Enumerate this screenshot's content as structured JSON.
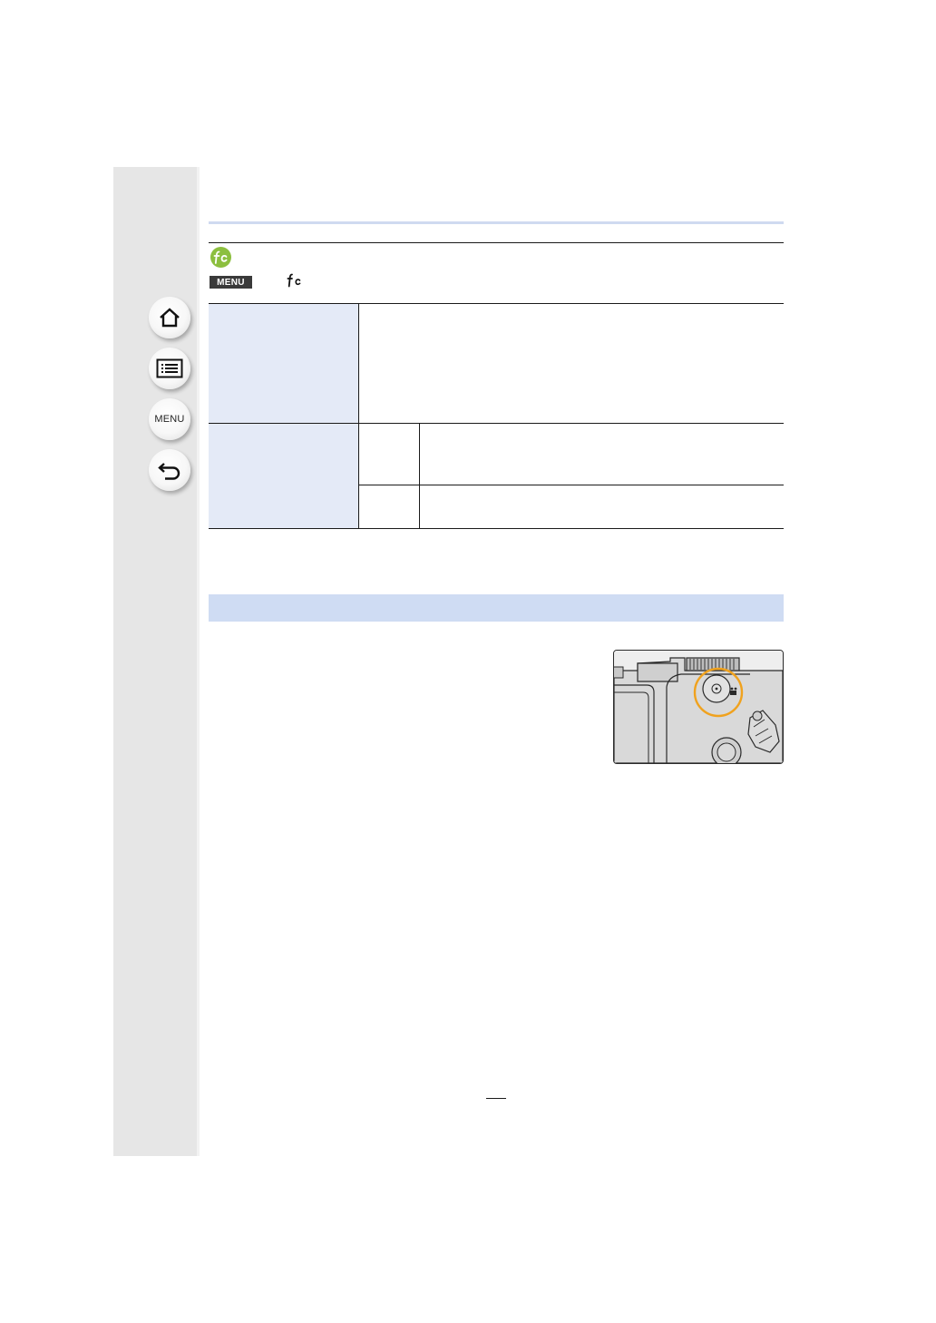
{
  "navigation": {
    "home": {
      "icon": "home-icon"
    },
    "contents": {
      "icon": "list-icon"
    },
    "menu": {
      "label": "MENU"
    },
    "back": {
      "icon": "back-arrow-icon"
    }
  },
  "header": {
    "menu_chip_label": "MENU",
    "custom_menu_icon": "fc-icon",
    "badge_icon": "fc-badge-icon",
    "accent_color": "#8cbf3f",
    "rule_color": "#cfdaf0"
  },
  "table": {
    "shade_color": "#e4eaf7"
  },
  "section": {
    "bar_color": "#cfdcf3"
  },
  "illustration": {
    "subject": "camera-top-mode-dial-illustration",
    "highlight_color": "#f0a21e"
  }
}
